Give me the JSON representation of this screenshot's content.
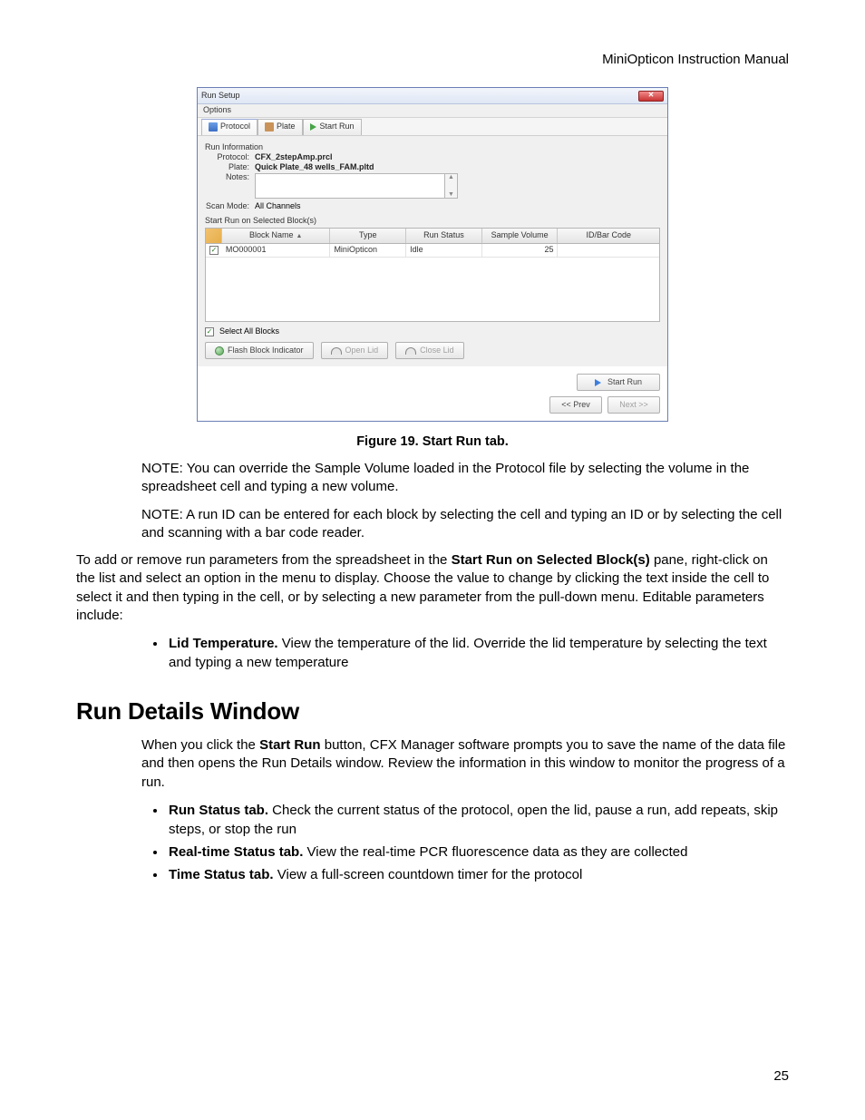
{
  "header": {
    "manual_title": "MiniOpticon Instruction Manual"
  },
  "window": {
    "title": "Run Setup",
    "menu_options": "Options",
    "tabs": {
      "protocol": "Protocol",
      "plate": "Plate",
      "start_run": "Start Run"
    },
    "run_info": {
      "section": "Run Information",
      "protocol_label": "Protocol:",
      "protocol_value": "CFX_2stepAmp.prcl",
      "plate_label": "Plate:",
      "plate_value": "Quick Plate_48 wells_FAM.pltd",
      "notes_label": "Notes:",
      "scan_label": "Scan Mode:",
      "scan_value": "All Channels"
    },
    "blocks": {
      "section": "Start Run on Selected Block(s)",
      "cols": {
        "name": "Block Name",
        "type": "Type",
        "status": "Run Status",
        "volume": "Sample Volume",
        "id": "ID/Bar Code"
      },
      "row": {
        "name": "MO000001",
        "type": "MiniOpticon",
        "status": "Idle",
        "volume": "25",
        "id": ""
      },
      "select_all": "Select All Blocks",
      "flash": "Flash Block Indicator",
      "open_lid": "Open Lid",
      "close_lid": "Close Lid"
    },
    "footer": {
      "start": "Start Run",
      "prev": "<< Prev",
      "next": "Next >>"
    }
  },
  "caption": "Figure 19. Start Run tab.",
  "note1": "NOTE: You can override the Sample Volume loaded in the Protocol file by selecting the volume in the spreadsheet cell and typing a new volume.",
  "note2": "NOTE: A run ID can be entered for each block by selecting the cell and typing an ID or by selecting the cell and scanning with a bar code reader.",
  "para1_a": "To add or remove run parameters from the spreadsheet in the ",
  "para1_b": "Start Run on Selected Block(s)",
  "para1_c": " pane, right-click on the list and select an option in the menu to display. Choose the value to change by clicking the text inside the cell to select it and then typing in the cell, or by selecting a new parameter from the pull-down menu. Editable parameters include:",
  "bullet1_a": "Lid Temperature.",
  "bullet1_b": " View the temperature of the lid. Override the lid temperature by selecting the text and typing a new temperature",
  "h2": "Run Details Window",
  "para2_a": "When you click the ",
  "para2_b": "Start Run",
  "para2_c": " button, CFX Manager software prompts you to save the name of the data file and then opens the Run Details window. Review the information in this window to monitor the progress of a run.",
  "b2a_h": "Run Status tab.",
  "b2a_t": " Check the current status of the protocol, open the lid, pause a run, add repeats, skip steps, or stop the run",
  "b2b_h": "Real-time Status tab.",
  "b2b_t": " View the real-time PCR fluorescence data as they are collected",
  "b2c_h": "Time Status tab.",
  "b2c_t": " View a full-screen countdown timer for the protocol",
  "pagenum": "25"
}
